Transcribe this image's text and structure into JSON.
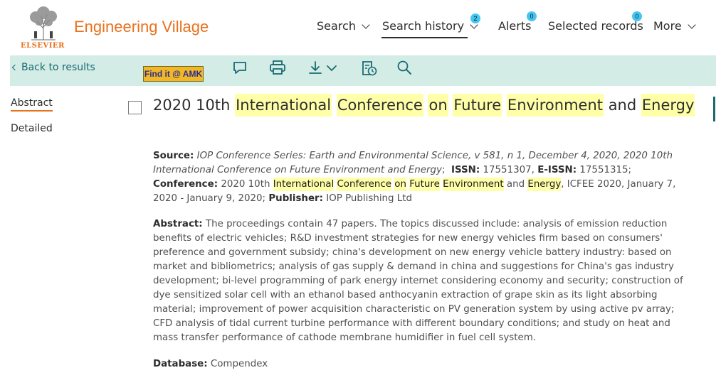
{
  "header": {
    "logo_text": "ELSEVIER",
    "brand": "Engineering Village",
    "nav": {
      "search": "Search",
      "search_history": "Search history",
      "search_history_badge": "2",
      "alerts": "Alerts",
      "alerts_badge": "0",
      "selected_records": "Selected records",
      "selected_records_badge": "0",
      "more": "More"
    }
  },
  "toolbar": {
    "back_label": "Back to results",
    "findit_label": "Find it @ AMK",
    "icons": [
      "comment-icon",
      "print-icon",
      "download-icon",
      "citation-history-icon",
      "search-icon"
    ]
  },
  "side_tabs": {
    "abstract": "Abstract",
    "detailed": "Detailed"
  },
  "record": {
    "title": {
      "t1": "2020 10th ",
      "h1": "International",
      "h2": "Conference",
      "h3": "on",
      "h4": "Future",
      "h5": "Environment",
      "t2": " and ",
      "h6": "Energy"
    },
    "source": {
      "label": "Source:",
      "journal": "IOP Conference Series: Earth and Environmental Science",
      "details": ", v 581, n 1, December 4, 2020,",
      "conf_italic": "2020 10th International Conference on Future Environment and Energy",
      "issn_label": "ISSN:",
      "issn": "17551307,",
      "eissn_label": "E-ISSN:",
      "eissn": "17551315;",
      "conference_label": "Conference:",
      "conf_pre": "2020 10th",
      "h1": "International",
      "h2": "Conference",
      "h3": "on",
      "h4": "Future",
      "h5": "Environment",
      "conf_and": " and ",
      "h6": "Energy",
      "conf_post": ", ICFEE 2020, January 7, 2020 - January 9, 2020;",
      "publisher_label": "Publisher:",
      "publisher": "IOP Publishing Ltd"
    },
    "abstract": {
      "label": "Abstract:",
      "text": "The proceedings contain 47 papers. The topics discussed include: analysis of emission reduction benefits of electric vehicles; R&D investment strategies for new energy vehicles firm based on consumers' preference and government subsidy; china's development on new energy vehicle battery industry: based on market and bibliometrics; analysis of gas supply & demand in china and suggestions for China's gas industry development; bi-level programming of park energy internet considering economy and security; construction of dye sensitized solar cell with an ethanol based anthocyanin extraction of grape skin as its light absorbing material; improvement of power acquisition characteristic on PV generation system by using active pv array; CFD analysis of tidal current turbine performance with different boundary conditions; and study on heat and mass transfer performance of cathode membrane humidifier in fuel cell system."
    },
    "database": {
      "label": "Database:",
      "value": "Compendex"
    }
  },
  "colors": {
    "brand_orange": "#e9711c",
    "toolbar_bg": "#d3ece6",
    "teal": "#1a6a72",
    "highlight": "#ffffa8",
    "badge": "#44c6f4",
    "findit_bg": "#f1b727"
  }
}
